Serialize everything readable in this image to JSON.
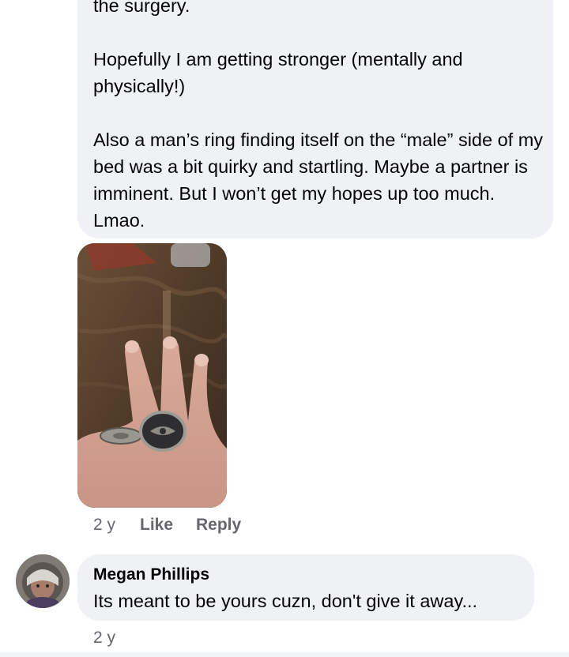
{
  "comment": {
    "paragraphs": [
      "the surgery.",
      "Hopefully I am getting stronger (mentally and physically!)",
      "Also a man’s ring finding itself on the “male” side of my bed was a bit quirky and startling.  Maybe a partner is imminent.  But I won’t get my hopes up too much.  Lmao."
    ],
    "photo_description": "hand-wearing-rings-photo",
    "time": "2 y",
    "like_label": "Like",
    "reply_label": "Reply"
  },
  "reply": {
    "author": "Megan Phillips",
    "text": "Its meant to be yours cuzn, don't give it away...",
    "time": "2 y"
  },
  "colors": {
    "bubble": "#eff1f5",
    "meta_text": "#65676b",
    "body_text": "#050505"
  }
}
